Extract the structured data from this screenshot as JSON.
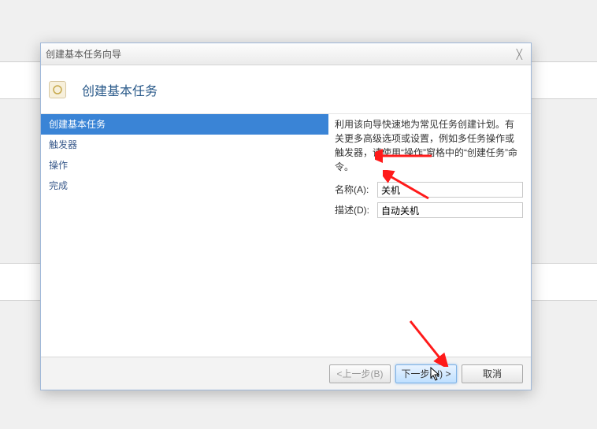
{
  "window": {
    "title": "创建基本任务向导"
  },
  "header": {
    "title": "创建基本任务"
  },
  "steps": [
    {
      "label": "创建基本任务",
      "active": true
    },
    {
      "label": "触发器",
      "active": false
    },
    {
      "label": "操作",
      "active": false
    },
    {
      "label": "完成",
      "active": false
    }
  ],
  "content": {
    "description": "利用该向导快速地为常见任务创建计划。有关更多高级选项或设置，例如多任务操作或触发器，请使用“操作”窗格中的“创建任务”命令。",
    "name_label": "名称(A):",
    "name_value": "关机",
    "desc_label": "描述(D):",
    "desc_value": "自动关机"
  },
  "buttons": {
    "back": "<上一步(B)",
    "next": "下一步(N) >",
    "cancel": "取消"
  }
}
